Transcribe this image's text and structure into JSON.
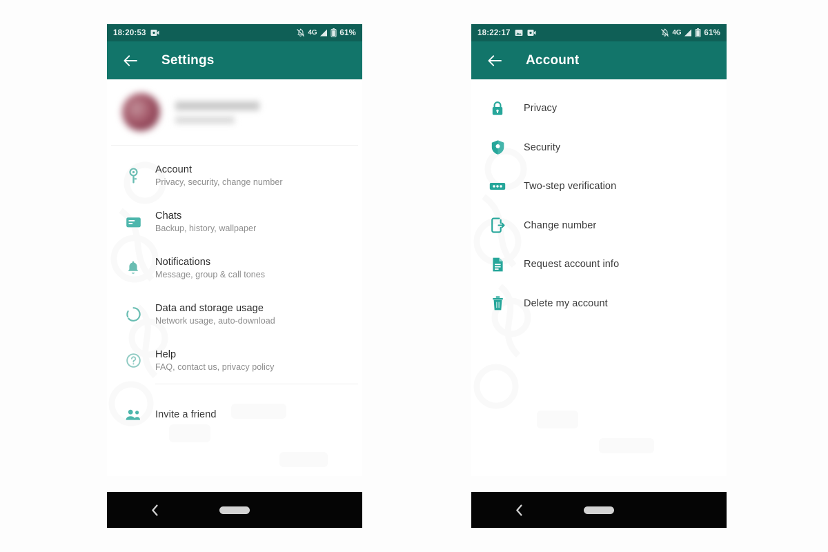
{
  "colors": {
    "status_bar": "#0f5f56",
    "app_bar": "#12756a",
    "icon_teal": "#4db6ac",
    "icon_teal_solid": "#26a69a",
    "title_text": "#2b2b2b",
    "sub_text": "#8d8d8d",
    "nav_bar": "#050505"
  },
  "settings_phone": {
    "status_bar": {
      "time": "18:20:53",
      "notification_icons": [
        "video-icon"
      ],
      "mute_icon": "bell-muted-icon",
      "network_label": "4G",
      "signal_icon": "signal-bars-icon",
      "battery_icon": "battery-icon",
      "battery_percent": "61%"
    },
    "app_bar": {
      "back_icon": "back-arrow-icon",
      "title": "Settings"
    },
    "profile": {
      "avatar": "profile-avatar",
      "name": "",
      "status": ""
    },
    "items": [
      {
        "icon": "key-icon",
        "title": "Account",
        "subtitle": "Privacy, security, change number"
      },
      {
        "icon": "chat-icon",
        "title": "Chats",
        "subtitle": "Backup, history, wallpaper"
      },
      {
        "icon": "bell-icon",
        "title": "Notifications",
        "subtitle": "Message, group & call tones"
      },
      {
        "icon": "data-icon",
        "title": "Data and storage usage",
        "subtitle": "Network usage, auto-download"
      },
      {
        "icon": "help-icon",
        "title": "Help",
        "subtitle": "FAQ, contact us, privacy policy"
      }
    ],
    "footer_items": [
      {
        "icon": "people-icon",
        "title": "Invite a friend"
      }
    ],
    "nav_bar": {
      "back_icon": "nav-back-icon",
      "home_pill": "nav-home-pill"
    }
  },
  "account_phone": {
    "status_bar": {
      "time": "18:22:17",
      "notification_icons": [
        "image-icon",
        "video-icon"
      ],
      "mute_icon": "bell-muted-icon",
      "network_label": "4G",
      "signal_icon": "signal-bars-icon",
      "battery_icon": "battery-icon",
      "battery_percent": "61%"
    },
    "app_bar": {
      "back_icon": "back-arrow-icon",
      "title": "Account"
    },
    "items": [
      {
        "icon": "lock-icon",
        "title": "Privacy"
      },
      {
        "icon": "shield-icon",
        "title": "Security"
      },
      {
        "icon": "dots-icon",
        "title": "Two-step verification"
      },
      {
        "icon": "phone-out-icon",
        "title": "Change number"
      },
      {
        "icon": "document-icon",
        "title": "Request account info"
      },
      {
        "icon": "trash-icon",
        "title": "Delete my account"
      }
    ],
    "nav_bar": {
      "back_icon": "nav-back-icon",
      "home_pill": "nav-home-pill"
    }
  }
}
